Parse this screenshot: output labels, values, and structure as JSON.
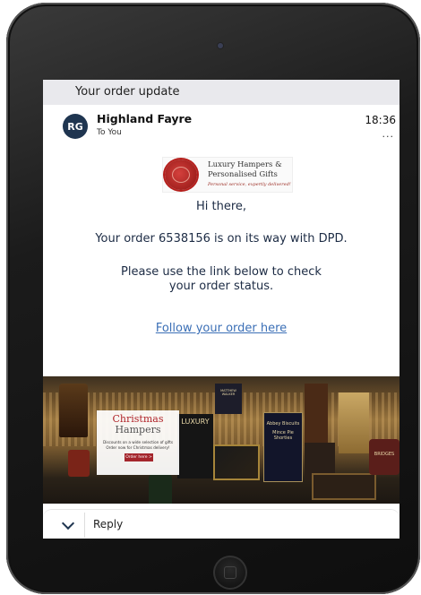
{
  "email": {
    "subject": "Your order update",
    "sender_initials": "RG",
    "sender_name": "Highland Fayre",
    "recipient": "To You",
    "time": "18:36",
    "more_label": "..."
  },
  "logo": {
    "line1": "Luxury Hampers &",
    "line2": "Personalised Gifts",
    "tagline": "Personal service, expertly delivered!"
  },
  "message": {
    "greeting": "Hi there,",
    "order_line": "Your order 6538156 is on its way with DPD.",
    "instruction_line1": "Please use the link below to check",
    "instruction_line2": "your order status.",
    "link_text": "Follow your order here"
  },
  "banner": {
    "promo_title": "Christmas",
    "promo_subtitle": "Hampers",
    "promo_line1": "Discounts on a wide selection of gifts",
    "promo_line2": "Order now for Christmas delivery!",
    "promo_button": "Order here >",
    "product_labels": [
      "LUXURY",
      "Mince Pie Shorties",
      "Abbey Biscuits",
      "BRIDGES",
      "MATTHEW WALKER"
    ]
  },
  "reply": {
    "label": "Reply"
  }
}
